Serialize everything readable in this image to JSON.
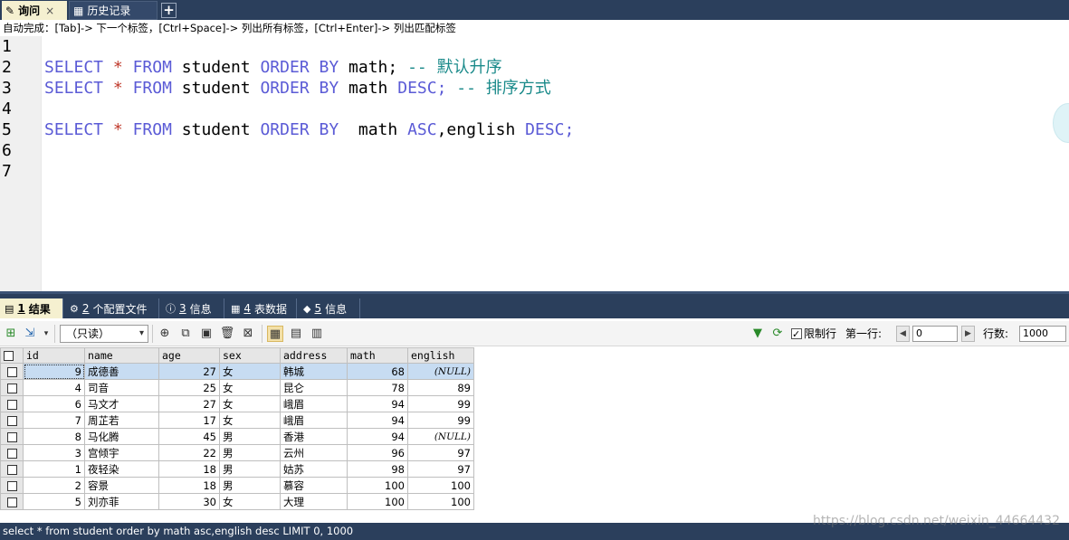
{
  "tabs": [
    {
      "label": "询问",
      "active": true,
      "close": "×"
    },
    {
      "label": "历史记录",
      "active": false
    }
  ],
  "add_tab": "+",
  "hint": "自动完成：[Tab]-> 下一个标签，[Ctrl+Space]-> 列出所有标签，[Ctrl+Enter]-> 列出匹配标签",
  "editor": {
    "line_numbers": [
      "1",
      "2",
      "3",
      "4",
      "5",
      "6",
      "7"
    ],
    "line2": {
      "select": "SELECT",
      "star": "*",
      "from": "FROM",
      "table": "student",
      "order": "ORDER",
      "by": "BY",
      "col": "math;",
      "comment": "-- 默认升序"
    },
    "line3": {
      "select": "SELECT",
      "star": "*",
      "from": "FROM",
      "table": "student",
      "order": "ORDER",
      "by": "BY",
      "col": "math",
      "desc": "DESC;",
      "comment": "-- 排序方式"
    },
    "line5": {
      "select": "SELECT",
      "star": "*",
      "from": "FROM",
      "table": "student",
      "order": "ORDER",
      "by": "BY",
      "col1": "math",
      "asc": "ASC",
      "col2": ",english",
      "desc": "DESC;"
    }
  },
  "result_tabs": [
    {
      "num": "1",
      "label": "结果",
      "active": true
    },
    {
      "num": "2",
      "label": "个配置文件",
      "active": false
    },
    {
      "num": "3",
      "label": "信息",
      "active": false
    },
    {
      "num": "4",
      "label": "表数据",
      "active": false
    },
    {
      "num": "5",
      "label": "信息",
      "active": false
    }
  ],
  "toolbar": {
    "mode_select": "（只读）",
    "limit_label": "限制行",
    "first_row_label": "第一行:",
    "first_row_value": "0",
    "rows_label": "行数:",
    "rows_value": "1000"
  },
  "grid": {
    "columns": [
      "id",
      "name",
      "age",
      "sex",
      "address",
      "math",
      "english"
    ],
    "rows": [
      [
        "9",
        "成德善",
        "27",
        "女",
        "韩城",
        "68",
        "(NULL)"
      ],
      [
        "4",
        "司音",
        "25",
        "女",
        "昆仑",
        "78",
        "89"
      ],
      [
        "6",
        "马文才",
        "27",
        "女",
        "峨眉",
        "94",
        "99"
      ],
      [
        "7",
        "周芷若",
        "17",
        "女",
        "峨眉",
        "94",
        "99"
      ],
      [
        "8",
        "马化腾",
        "45",
        "男",
        "香港",
        "94",
        "(NULL)"
      ],
      [
        "3",
        "宫倾宇",
        "22",
        "男",
        "云州",
        "96",
        "97"
      ],
      [
        "1",
        "夜轻染",
        "18",
        "男",
        "姑苏",
        "98",
        "97"
      ],
      [
        "2",
        "容景",
        "18",
        "男",
        "慕容",
        "100",
        "100"
      ],
      [
        "5",
        "刘亦菲",
        "30",
        "女",
        "大理",
        "100",
        "100"
      ]
    ]
  },
  "status": "select * from student order by math asc,english desc LIMIT 0, 1000",
  "watermark": "https://blog.csdn.net/weixin_44664432"
}
